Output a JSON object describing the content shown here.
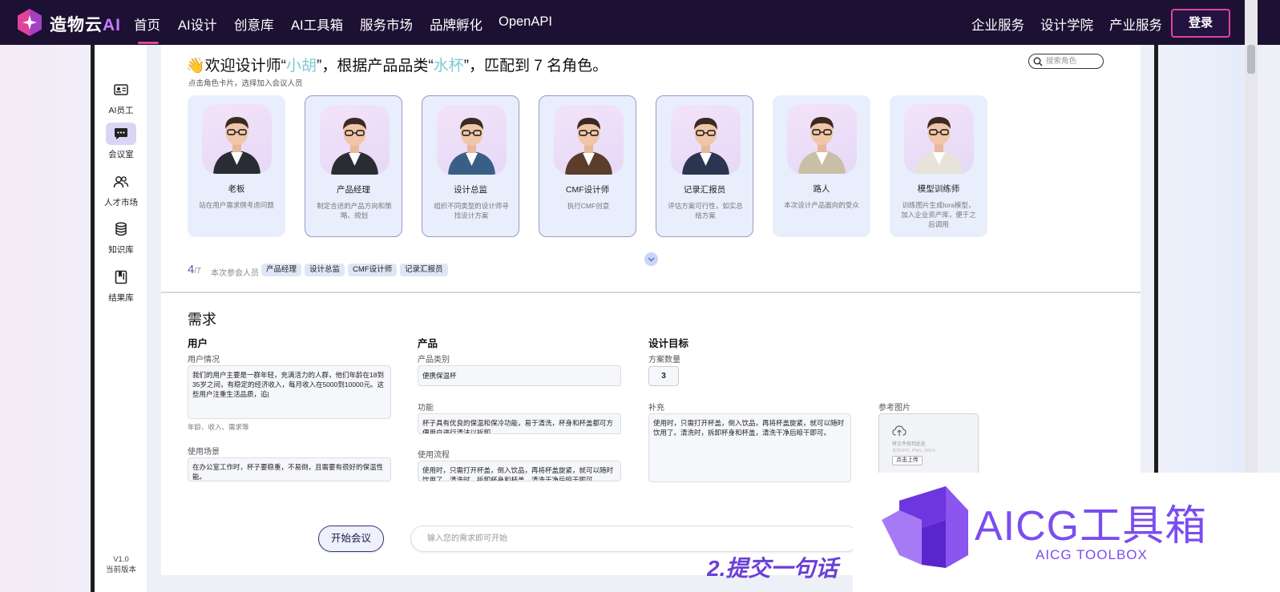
{
  "topnav": {
    "brand": "造物云",
    "brand_ai": "AI",
    "items": [
      "首页",
      "AI设计",
      "创意库",
      "AI工具箱",
      "服务市场",
      "品牌孵化",
      "OpenAPI"
    ],
    "right_items": [
      "企业服务",
      "设计学院",
      "产业服务"
    ],
    "login": "登录"
  },
  "sidebar": {
    "items": [
      {
        "label": "AI员工",
        "icon": "id-card-icon"
      },
      {
        "label": "会议室",
        "icon": "chat-bubble-icon"
      },
      {
        "label": "人才市场",
        "icon": "people-icon"
      },
      {
        "label": "知识库",
        "icon": "database-icon"
      },
      {
        "label": "结果库",
        "icon": "bookmark-icon"
      }
    ],
    "active_index": 1,
    "version": "V1.0",
    "version_label": "当前版本"
  },
  "welcome": {
    "prefix": "👋欢迎设计师“",
    "designer": "小胡",
    "mid": "”，根据产品品类“",
    "category": "水杯",
    "suffix": "”，匹配到 7 名角色。",
    "hint": "点击角色卡片，选择加入会议人员",
    "search_placeholder": "搜索角色"
  },
  "roles": [
    {
      "name": "老板",
      "desc": "站在用户需求侧考虑问题",
      "selected": false
    },
    {
      "name": "产品经理",
      "desc": "制定合适的产品方向和策略、规划",
      "selected": true
    },
    {
      "name": "设计总监",
      "desc": "组织不同类型的设计师寻找设计方案",
      "selected": true
    },
    {
      "name": "CMF设计师",
      "desc": "执行CMF创意",
      "selected": true
    },
    {
      "name": "记录汇报员",
      "desc": "评估方案可行性，如实总结方案",
      "selected": true
    },
    {
      "name": "路人",
      "desc": "本次设计产品面向的受众",
      "selected": false
    },
    {
      "name": "模型训练师",
      "desc": "训练图片生成lora模型，加入企业资产库，便于之后调用",
      "selected": false
    }
  ],
  "participants": {
    "count": "4",
    "total": "/7",
    "label": "本次参会人员",
    "chips": [
      "产品经理",
      "设计总监",
      "CMF设计师",
      "记录汇报员"
    ]
  },
  "requirements": {
    "title": "需求",
    "user": {
      "title": "用户",
      "situation_label": "用户情况",
      "situation_value": "我们的用户主要是一群年轻，充满活力的人群，他们年龄在18到35岁之间，有稳定的经济收入，每月收入在5000到10000元。这些用户注重生活品质，追|",
      "situation_hint": "年龄、收入、需求等",
      "scene_label": "使用场景",
      "scene_value": "在办公室工作时，杯子要稳重，不易倒，且需要有很好的保温性能。"
    },
    "product": {
      "title": "产品",
      "category_label": "产品类别",
      "category_value": "便携保温杯",
      "function_label": "功能",
      "function_value": "杯子具有优良的保温和保冷功能，易于清洗，杯身和杯盖都可方便用户进行清洁以拆卸。",
      "flow_label": "使用流程",
      "flow_value": "使用时，只需打开杯盖，倒入饮品，再将杯盖旋紧，就可以随时饮用了。清洗时，拆卸杯身和杯盖，清洗干净后晾干即可。"
    },
    "goal": {
      "title": "设计目标",
      "qty_label": "方案数量",
      "qty_value": "3",
      "supplement_label": "补充",
      "supplement_value": "使用时，只需打开杯盖，倒入饮品，再将杯盖旋紧，就可以随时饮用了。清洗时，拆卸杯身和杯盖，清洗干净后晾干即可。",
      "ref_label": "参考图片",
      "upload_hint": "将文件拖到此处",
      "upload_formats": "支持JPG, PNG, JPEG",
      "upload_btn": "点击上传"
    }
  },
  "actions": {
    "start": "开始会议",
    "input_placeholder": "输入您的需求即可开始"
  },
  "watermark": {
    "title": "AICG工具箱",
    "sub": "AICG TOOLBOX",
    "caption": "2.提交一句话"
  },
  "colors": {
    "nav_bg": "#1c1033",
    "accent_pink": "#e0449a",
    "highlight": "#7fc9d6",
    "card_bg": "#e9eefd",
    "watermark": "#7b4df0"
  }
}
